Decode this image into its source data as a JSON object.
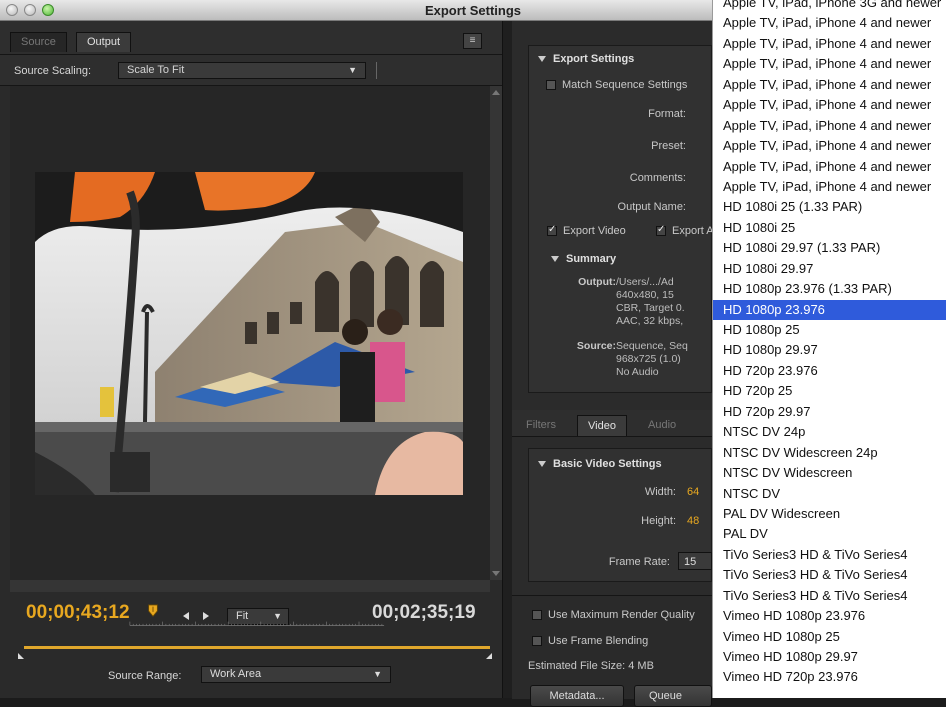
{
  "window": {
    "title": "Export Settings"
  },
  "left": {
    "tabs": [
      "Source",
      "Output"
    ],
    "panel_menu_icon": "≡",
    "scaling_label": "Source Scaling:",
    "scaling_value": "Scale To Fit",
    "current_time": "00;00;43;12",
    "duration": "00;02;35;19",
    "zoom_value": "Fit",
    "source_range_label": "Source Range:",
    "source_range_value": "Work Area"
  },
  "right": {
    "export_settings_header": "Export Settings",
    "match_sequence": "Match Sequence Settings",
    "format_label": "Format:",
    "preset_label": "Preset:",
    "comments_label": "Comments:",
    "output_name_label": "Output Name:",
    "export_video": "Export Video",
    "export_audio": "Export Audio",
    "summary_header": "Summary",
    "output_label": "Output:",
    "output_lines": [
      "/Users/.../Ad",
      "640x480, 15",
      "CBR, Target 0.",
      "AAC, 32 kbps,"
    ],
    "source_label": "Source:",
    "source_lines": [
      "Sequence, Seq",
      "968x725 (1.0)",
      "No Audio"
    ],
    "tabs": [
      "Filters",
      "Video",
      "Audio"
    ],
    "basic_header": "Basic Video Settings",
    "width_label": "Width:",
    "width_value": "64",
    "height_label": "Height:",
    "height_value": "48",
    "frame_rate_label": "Frame Rate:",
    "frame_rate_value": "15",
    "max_render": "Use Maximum Render Quality",
    "frame_blending": "Use Frame Blending",
    "file_size": "Estimated File Size: 4 MB",
    "metadata_btn": "Metadata...",
    "queue_btn": "Queue"
  },
  "dropdown": {
    "selected_index": 15,
    "items": [
      "Apple TV, iPad, iPhone 3G and newer",
      "Apple TV, iPad, iPhone 4 and newer",
      "Apple TV, iPad, iPhone 4 and newer",
      "Apple TV, iPad, iPhone 4 and newer",
      "Apple TV, iPad, iPhone 4 and newer",
      "Apple TV, iPad, iPhone 4 and newer",
      "Apple TV, iPad, iPhone 4 and newer",
      "Apple TV, iPad, iPhone 4 and newer",
      "Apple TV, iPad, iPhone 4 and newer",
      "Apple TV, iPad, iPhone 4 and newer",
      "HD 1080i 25 (1.33 PAR)",
      "HD 1080i 25",
      "HD 1080i 29.97 (1.33 PAR)",
      "HD 1080i 29.97",
      "HD 1080p 23.976 (1.33 PAR)",
      "HD 1080p 23.976",
      "HD 1080p 25",
      "HD 1080p 29.97",
      "HD 720p 23.976",
      "HD 720p 25",
      "HD 720p 29.97",
      "NTSC DV 24p",
      "NTSC DV Widescreen 24p",
      "NTSC DV Widescreen",
      "NTSC DV",
      "PAL DV Widescreen",
      "PAL DV",
      "TiVo Series3 HD & TiVo Series4",
      "TiVo Series3 HD & TiVo Series4",
      "TiVo Series3 HD & TiVo Series4",
      "Vimeo HD 1080p 23.976",
      "Vimeo HD 1080p 25",
      "Vimeo HD 1080p 29.97",
      "Vimeo HD 720p 23.976"
    ]
  },
  "colors": {
    "accent_orange": "#e8a820",
    "selection_blue": "#2f5bdb",
    "panel_bg": "#2a2a2a"
  }
}
